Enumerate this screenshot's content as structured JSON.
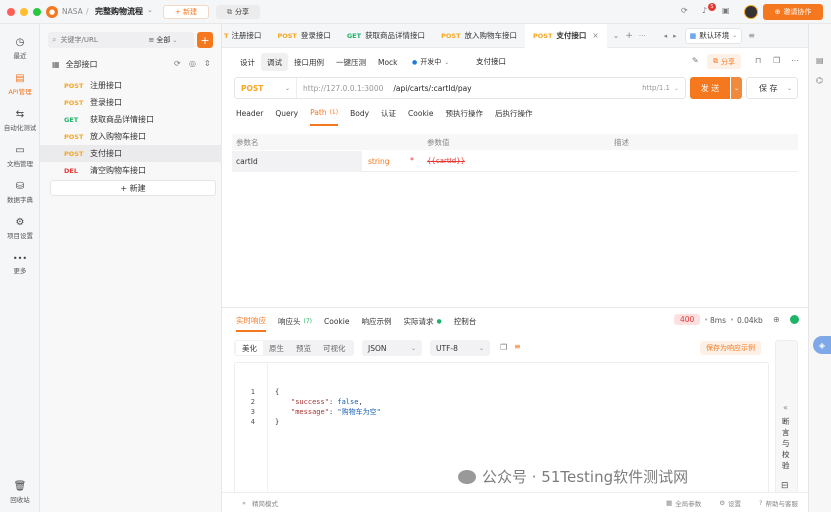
{
  "titlebar": {
    "team": "NASA",
    "sep": "/",
    "project": "完整购物流程",
    "new_btn": "+ 新建",
    "share_btn": "分享",
    "notify_count": "5",
    "invite_btn": "邀请协作"
  },
  "leftnav": {
    "items": [
      {
        "icon": "◷",
        "label": "最近"
      },
      {
        "icon": "▤",
        "label": "API管理"
      },
      {
        "icon": "⇆",
        "label": "自动化测试"
      },
      {
        "icon": "▭",
        "label": "文档管理"
      },
      {
        "icon": "⛁",
        "label": "数据字典"
      },
      {
        "icon": "⚙",
        "label": "项目设置"
      },
      {
        "icon": "•••",
        "label": "更多"
      }
    ],
    "trash_label": "回收站"
  },
  "tree": {
    "search_placeholder": "关键字/URL",
    "filter": "全部",
    "root": "全部接口",
    "items": [
      {
        "method": "POST",
        "name": "注册接口"
      },
      {
        "method": "POST",
        "name": "登录接口"
      },
      {
        "method": "GET",
        "name": "获取商品详情接口"
      },
      {
        "method": "POST",
        "name": "放入购物车接口"
      },
      {
        "method": "POST",
        "name": "支付接口"
      },
      {
        "method": "DEL",
        "name": "清空购物车接口"
      }
    ],
    "new_btn": "+ 新建"
  },
  "tabs": {
    "items": [
      {
        "method": "T",
        "name": "注册接口"
      },
      {
        "method": "POST",
        "name": "登录接口"
      },
      {
        "method": "GET",
        "name": "获取商品详情接口"
      },
      {
        "method": "POST",
        "name": "放入购物车接口"
      },
      {
        "method": "POST",
        "name": "支付接口"
      }
    ],
    "env": "默认环境"
  },
  "subtabs": {
    "items": [
      "设计",
      "调试",
      "接口用例",
      "一键压测",
      "Mock"
    ],
    "status": "开发中",
    "api_name": "支付接口",
    "share": "分享"
  },
  "request": {
    "method": "POST",
    "base_url": "http://127.0.0.1:3000",
    "path": "/api/carts/:cartId/pay",
    "protocol": "http/1.1",
    "send": "发 送",
    "save": "保 存"
  },
  "param_tabs": {
    "items": [
      "Header",
      "Query",
      "Path",
      "Body",
      "认证",
      "Cookie",
      "预执行操作",
      "后执行操作"
    ],
    "path_count": "(1)"
  },
  "params_table": {
    "headers": [
      "参数名",
      "参数值",
      "描述"
    ],
    "row": {
      "name": "cartId",
      "type": "string",
      "required": "*",
      "value": "{{cartId}}"
    }
  },
  "response": {
    "tabs": [
      "实时响应",
      "响应头",
      "Cookie",
      "响应示例",
      "实际请求",
      "控制台"
    ],
    "header_count": "(7)",
    "status": "400",
    "time": "8ms",
    "size": "0.04kb",
    "view_modes": [
      "美化",
      "原生",
      "预览",
      "可视化"
    ],
    "format": "JSON",
    "encoding": "UTF-8",
    "save_example": "保存为响应示例",
    "lines": [
      {
        "num": "1",
        "text": "{"
      },
      {
        "num": "2",
        "key": "\"success\"",
        "colon": ": ",
        "val": "false",
        "tail": ","
      },
      {
        "num": "3",
        "key": "\"message\"",
        "colon": ": ",
        "val": "\"购物车为空\"",
        "tail": ""
      },
      {
        "num": "4",
        "text": "}"
      }
    ],
    "side_panel": [
      "断",
      "言",
      "与",
      "校",
      "验"
    ]
  },
  "footer": {
    "mode": "精简模式",
    "global_params": "全局参数",
    "settings": "设置",
    "help": "帮助与客服"
  },
  "watermark": "公众号 · 51Testing软件测试网",
  "colors": {
    "accent": "#f5771e",
    "post": "#f5a623",
    "get": "#1fb36a",
    "del": "#e53935"
  }
}
